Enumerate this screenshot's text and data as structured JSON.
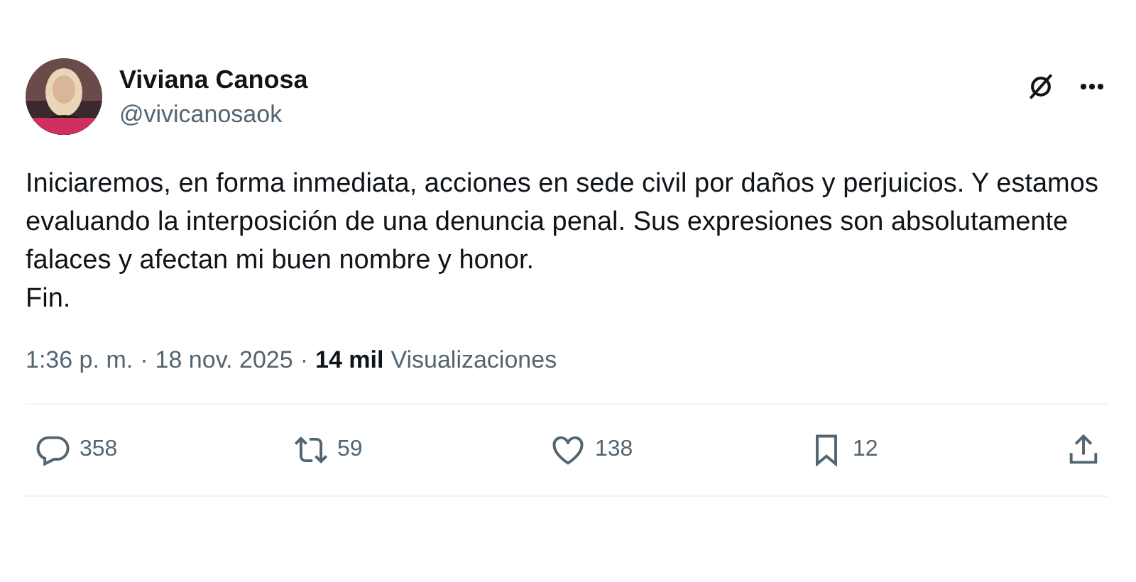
{
  "author": {
    "name": "Viviana Canosa",
    "handle": "@vivicanosaok"
  },
  "paragraphs": [
    "Iniciaremos, en forma inmediata, acciones en sede civil por daños y perjuicios. Y estamos evaluando la interposición de una denuncia penal. Sus expresiones son absolutamente falaces y afectan mi buen nombre y honor.",
    "Fin."
  ],
  "meta": {
    "time": "1:36 p. m.",
    "separator": "·",
    "date": "18 nov. 2025",
    "views_count": "14 mil",
    "views_label": "Visualizaciones"
  },
  "actions": [
    {
      "kind": "reply",
      "count": "358"
    },
    {
      "kind": "repost",
      "count": "59"
    },
    {
      "kind": "like",
      "count": "138"
    },
    {
      "kind": "bookmark",
      "count": "12"
    },
    {
      "kind": "share"
    }
  ]
}
